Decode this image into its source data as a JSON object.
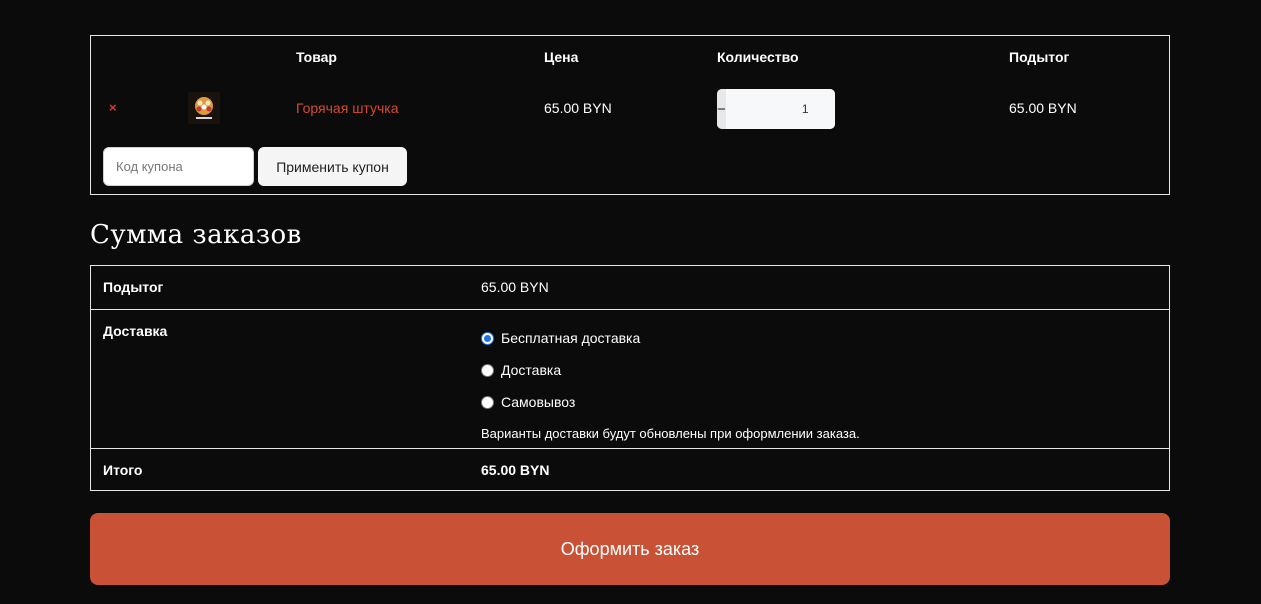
{
  "cart": {
    "headers": {
      "product": "Товар",
      "price": "Цена",
      "quantity": "Количество",
      "subtotal": "Подытог"
    },
    "item": {
      "remove": "×",
      "name": "Горячая штучка",
      "price": "65.00 BYN",
      "quantity": "1",
      "subtotal": "65.00 BYN"
    },
    "qty_minus": "−",
    "qty_plus": "+",
    "coupon_placeholder": "Код купона",
    "apply_coupon": "Применить купон"
  },
  "totals": {
    "title": "Сумма заказов",
    "subtotal_label": "Подытог",
    "subtotal_value": "65.00 BYN",
    "shipping_label": "Доставка",
    "shipping_options": [
      {
        "label": "Бесплатная доставка",
        "selected": true
      },
      {
        "label": "Доставка",
        "selected": false
      },
      {
        "label": "Самовывоз",
        "selected": false
      }
    ],
    "shipping_note": "Варианты доставки будут обновлены при оформлении заказа.",
    "total_label": "Итого",
    "total_value": "65.00 BYN"
  },
  "checkout_label": "Оформить заказ",
  "colors": {
    "background": "#0b0b0b",
    "accent": "#c95236",
    "link": "#d44a36",
    "radio_selected": "#1a73e8"
  }
}
